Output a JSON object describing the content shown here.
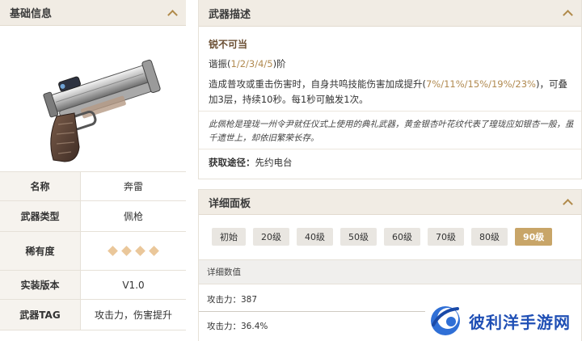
{
  "basic_info": {
    "title": "基础信息",
    "rows": [
      {
        "key": "名称",
        "value": "奔雷"
      },
      {
        "key": "武器类型",
        "value": "佩枪"
      },
      {
        "key": "稀有度",
        "value": "",
        "stars": 4
      },
      {
        "key": "实装版本",
        "value": "V1.0"
      },
      {
        "key": "武器TAG",
        "value": "攻击力，伤害提升"
      }
    ]
  },
  "description": {
    "title": "武器描述",
    "subtitle": "锐不可当",
    "harmony_prefix": "谐振(",
    "harmony_levels": "1/2/3/4/5",
    "harmony_suffix": ")阶",
    "effect_prefix": "造成普攻或重击伤害时，自身共鸣技能伤害加成提升(",
    "effect_values": "7%/11%/15%/19%/23%",
    "effect_suffix": ")，可叠加3层，持续10秒。每1秒可触发1次。",
    "flavor": "此佩枪是瑝珑一州令尹就任仪式上使用的典礼武器，黄金银杏叶花纹代表了瑝珑应如银杏一般，虽千遗世上，却依旧繁荣长存。",
    "source_label": "获取途径：",
    "source_value": "先约电台"
  },
  "detail_panel": {
    "title": "详细面板",
    "levels": [
      "初始",
      "20级",
      "40级",
      "50级",
      "60级",
      "70级",
      "80级",
      "90级"
    ],
    "active_level": "90级",
    "table_header": "详细数值",
    "stat1": "攻击力：387",
    "stat2": "攻击力：36.4%"
  },
  "watermark": {
    "text": "彼利洋手游网"
  },
  "colors": {
    "accent": "#b18a50",
    "header_bg": "#f1ece4",
    "active_button": "#c8a568",
    "watermark": "#1f4fb5"
  }
}
